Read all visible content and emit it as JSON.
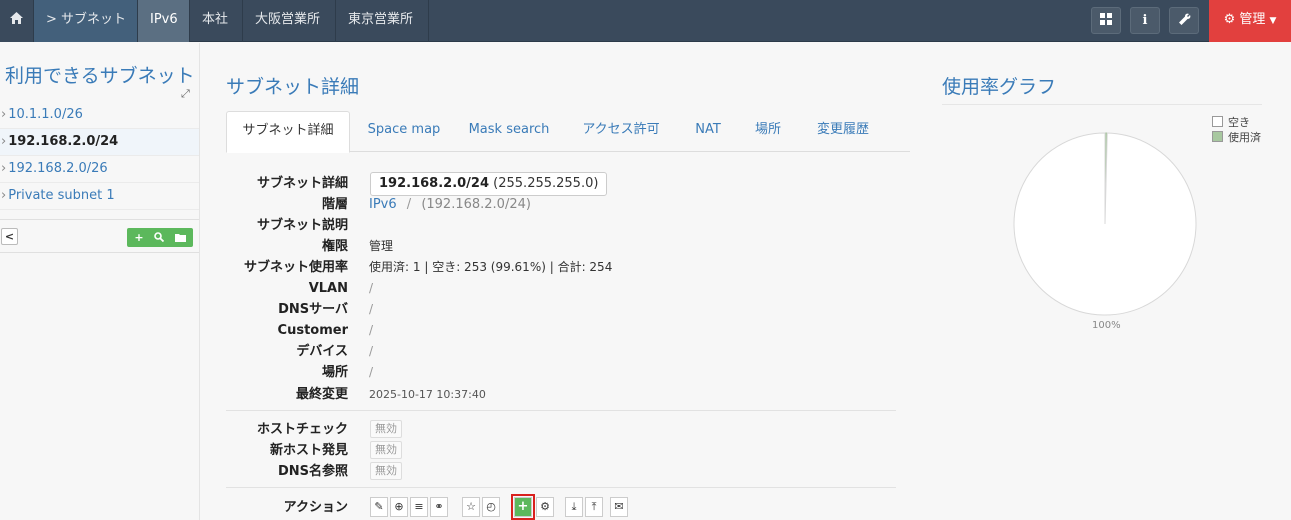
{
  "nav": {
    "home_icon": "home-icon",
    "subnets_label": "> サブネット",
    "items": [
      "IPv6",
      "本社",
      "大阪営業所",
      "東京営業所"
    ],
    "tools": [
      "grid-icon",
      "info-icon",
      "wrench-icon"
    ],
    "admin_label": "管理",
    "admin_icon": "gear-icon",
    "admin_color": "#e2403e"
  },
  "sidebar": {
    "title": "利用できるサブネット",
    "subnets": [
      {
        "label": "10.1.1.0/26",
        "active": false
      },
      {
        "label": "192.168.2.0/24",
        "active": true
      },
      {
        "label": "192.168.2.0/26",
        "active": false
      },
      {
        "label": "Private subnet 1",
        "active": false
      }
    ],
    "toolbar_icons": [
      "plus-icon",
      "search-icon",
      "folder-icon"
    ]
  },
  "main": {
    "title": "サブネット詳細",
    "tabs": [
      "サブネット詳細",
      "Space map",
      "Mask search",
      "アクセス許可",
      "NAT",
      "場所",
      "変更履歴"
    ],
    "details": {
      "subnet_label": "サブネット詳細",
      "subnet_value": "192.168.2.0/24",
      "subnet_mask": "(255.255.255.0)",
      "hierarchy_label": "階層",
      "hierarchy_link": "IPv6",
      "hierarchy_sep": "/",
      "hierarchy_rest": "(192.168.2.0/24)",
      "description_label": "サブネット説明",
      "permission_label": "権限",
      "permission_value": "管理",
      "usage_label": "サブネット使用率",
      "usage_used_label": "使用済:",
      "usage_used": "1",
      "usage_rest": "| 空き: 253 (99.61%) | 合計: 254",
      "vlan_label": "VLAN",
      "vlan_value": "/",
      "dns_label": "DNSサーバ",
      "dns_value": "/",
      "customer_label": "Customer",
      "customer_value": "/",
      "device_label": "デバイス",
      "device_value": "/",
      "location_label": "場所",
      "location_value": "/",
      "modified_label": "最終変更",
      "modified_value": "2025-10-17 10:37:40"
    },
    "checks": [
      {
        "label": "ホストチェック",
        "value": "無効"
      },
      {
        "label": "新ホスト発見",
        "value": "無効"
      },
      {
        "label": "DNS名参照",
        "value": "無効"
      }
    ],
    "actions_label": "アクション",
    "action_icons": [
      "pencil-icon",
      "plus-circle-icon",
      "list-icon",
      "link-icon",
      "star-icon",
      "clock-icon",
      "add-icon",
      "gears-icon",
      "download-icon",
      "upload-icon",
      "envelope-icon"
    ]
  },
  "graph": {
    "title": "使用率グラフ",
    "legend": [
      {
        "label": "空き",
        "color": "#ffffff"
      },
      {
        "label": "使用済",
        "color": "#a8c8a0"
      }
    ]
  },
  "chart_data": {
    "type": "pie",
    "categories": [
      "空き",
      "使用済"
    ],
    "values": [
      253,
      1
    ],
    "slice_label": "100%"
  }
}
